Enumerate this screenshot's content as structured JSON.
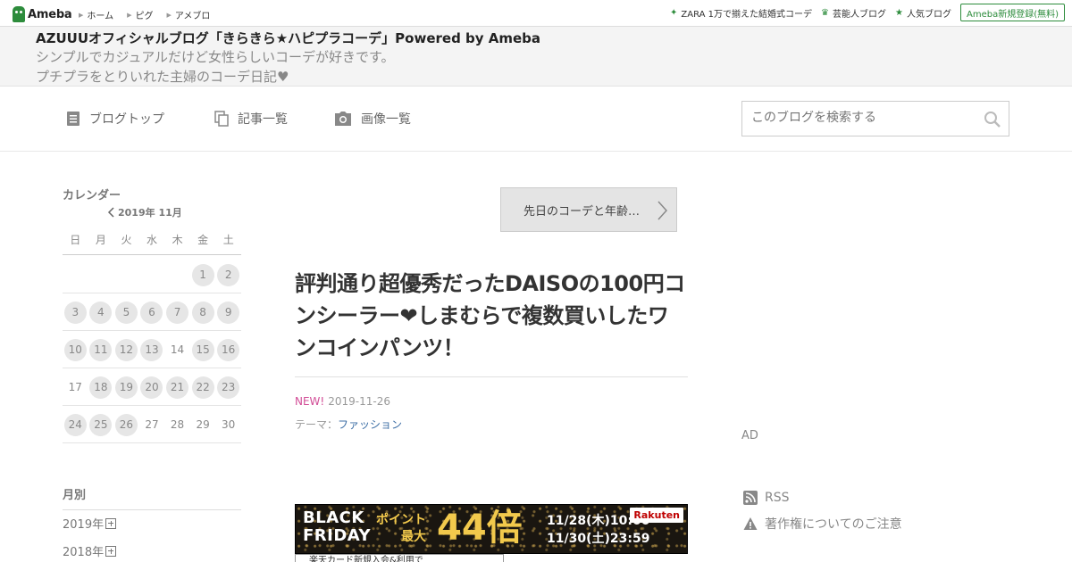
{
  "topbar": {
    "logo_text": "Ameba",
    "nav": [
      "ホーム",
      "ピグ",
      "アメブロ"
    ],
    "right_links": [
      {
        "label": "ZARA 1万で揃えた結婚式コーデ",
        "icon": "sparkle-icon"
      },
      {
        "label": "芸能人ブログ",
        "icon": "crown-icon"
      },
      {
        "label": "人気ブログ",
        "icon": "star-icon"
      }
    ],
    "signup_label": "Ameba新規登録(無料)"
  },
  "blog": {
    "title": "AZUUUオフィシャルブログ「きらきら★ハピプラコーデ」Powered by Ameba",
    "desc_line1": "シンプルでカジュアルだけど女性らしいコーデが好きです。",
    "desc_line2": "プチプラをとりいれた主婦のコーデ日記♥"
  },
  "nav": {
    "items": [
      {
        "label": "ブログトップ",
        "icon": "document-icon"
      },
      {
        "label": "記事一覧",
        "icon": "copy-icon"
      },
      {
        "label": "画像一覧",
        "icon": "camera-icon"
      }
    ],
    "search_placeholder": "このブログを検索する"
  },
  "calendar": {
    "title": "カレンダー",
    "month": "2019年 11月",
    "weekdays": [
      "日",
      "月",
      "火",
      "水",
      "木",
      "金",
      "土"
    ],
    "weeks": [
      [
        {
          "d": "",
          "has": false
        },
        {
          "d": "",
          "has": false
        },
        {
          "d": "",
          "has": false
        },
        {
          "d": "",
          "has": false
        },
        {
          "d": "",
          "has": false
        },
        {
          "d": "1",
          "has": true
        },
        {
          "d": "2",
          "has": true
        }
      ],
      [
        {
          "d": "3",
          "has": true
        },
        {
          "d": "4",
          "has": true
        },
        {
          "d": "5",
          "has": true
        },
        {
          "d": "6",
          "has": true
        },
        {
          "d": "7",
          "has": true
        },
        {
          "d": "8",
          "has": true
        },
        {
          "d": "9",
          "has": true
        }
      ],
      [
        {
          "d": "10",
          "has": true
        },
        {
          "d": "11",
          "has": true
        },
        {
          "d": "12",
          "has": true
        },
        {
          "d": "13",
          "has": true
        },
        {
          "d": "14",
          "has": false
        },
        {
          "d": "15",
          "has": true
        },
        {
          "d": "16",
          "has": true
        }
      ],
      [
        {
          "d": "17",
          "has": false
        },
        {
          "d": "18",
          "has": true
        },
        {
          "d": "19",
          "has": true
        },
        {
          "d": "20",
          "has": true
        },
        {
          "d": "21",
          "has": true
        },
        {
          "d": "22",
          "has": true
        },
        {
          "d": "23",
          "has": true
        }
      ],
      [
        {
          "d": "24",
          "has": true
        },
        {
          "d": "25",
          "has": true
        },
        {
          "d": "26",
          "has": true
        },
        {
          "d": "27",
          "has": false
        },
        {
          "d": "28",
          "has": false
        },
        {
          "d": "29",
          "has": false
        },
        {
          "d": "30",
          "has": false
        }
      ]
    ]
  },
  "monthly": {
    "title": "月別",
    "items": [
      "2019年",
      "2018年"
    ]
  },
  "article": {
    "next_label": "先日のコーデと年齢…",
    "title": "評判通り超優秀だったDAISOの100円コンシーラー❤しまむらで複数買いしたワンコインパンツ！",
    "new_badge": "NEW!",
    "date": "2019-11-26",
    "theme_prefix": "テーマ：",
    "theme": "ファッション"
  },
  "banner": {
    "line1": "BLACK",
    "line2": "FRIDAY",
    "point_line1": "ポイント",
    "point_line2": "最大",
    "multiplier": "44倍",
    "date1": "11/28(木)10:00〜",
    "date2": "11/30(土)23:59",
    "brand": "Rakuten",
    "sub_text": "楽天カード新規入会&利用で"
  },
  "right": {
    "ad_label": "AD",
    "links": [
      {
        "label": "RSS",
        "icon": "rss-icon"
      },
      {
        "label": "著作権についてのご注意",
        "icon": "warning-icon"
      }
    ]
  }
}
